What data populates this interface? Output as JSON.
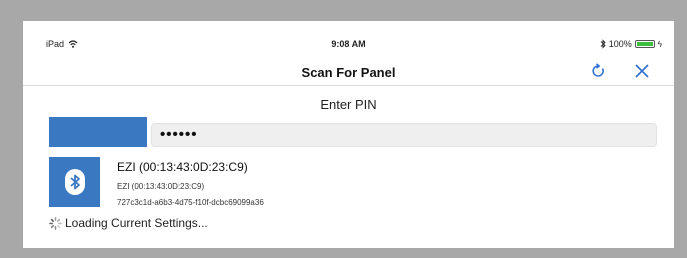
{
  "status_bar": {
    "device": "iPad",
    "time": "9:08 AM",
    "battery": "100%",
    "icons": [
      "wifi-icon",
      "bluetooth-icon",
      "battery-icon",
      "charging-icon"
    ]
  },
  "nav": {
    "title": "Scan For Panel",
    "icons": [
      "refresh-icon",
      "close-icon"
    ]
  },
  "pin": {
    "label": "Enter PIN",
    "value": "••••••"
  },
  "device": {
    "name": "EZI (00:13:43:0D:23:C9)",
    "sub_name": "EZI (00:13:43:0D:23:C9)",
    "uuid": "727c3c1d-a6b3-4d75-f10f-dcbc69099a36",
    "icon": "bluetooth-icon"
  },
  "loading": {
    "text": "Loading Current Settings..."
  },
  "colors": {
    "accent_blue": "#3a78c2",
    "battery_green": "#3bbf3b",
    "frame_gray": "#a8a8a8"
  }
}
